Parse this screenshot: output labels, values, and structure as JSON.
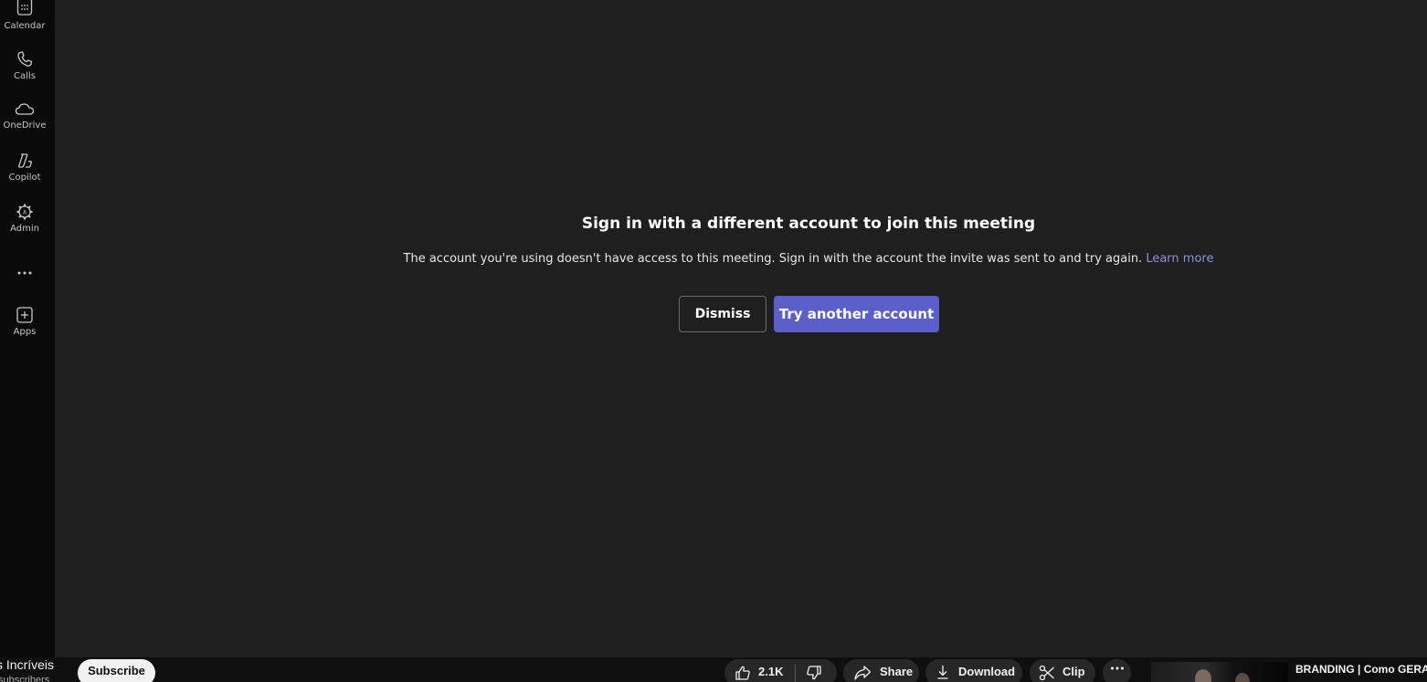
{
  "rail": {
    "items": [
      {
        "label": "Calendar",
        "icon": "calendar-icon"
      },
      {
        "label": "Calls",
        "icon": "phone-icon"
      },
      {
        "label": "OneDrive",
        "icon": "cloud-icon"
      },
      {
        "label": "Copilot",
        "icon": "copilot-icon"
      },
      {
        "label": "Admin",
        "icon": "admin-gear-icon"
      },
      {
        "label": "Apps",
        "icon": "add-apps-icon"
      }
    ],
    "more_icon": "more-horizontal-icon"
  },
  "dialog": {
    "title": "Sign in with a different account to join this meeting",
    "message": "The account you're using doesn't have access to this meeting. Sign in with the account the invite was sent to and try again.",
    "learn_more": "Learn more",
    "dismiss_label": "Dismiss",
    "primary_label": "Try another account",
    "primary_color": "#5b5fc7",
    "link_color": "#8e8fdc"
  },
  "youtube": {
    "channel_name": "s Incríveis",
    "channel_subs": "subscribers",
    "subscribe_label": "Subscribe",
    "like_count": "2.1K",
    "share_label": "Share",
    "download_label": "Download",
    "clip_label": "Clip",
    "next_video_title": "BRANDING | Como GERAR"
  }
}
